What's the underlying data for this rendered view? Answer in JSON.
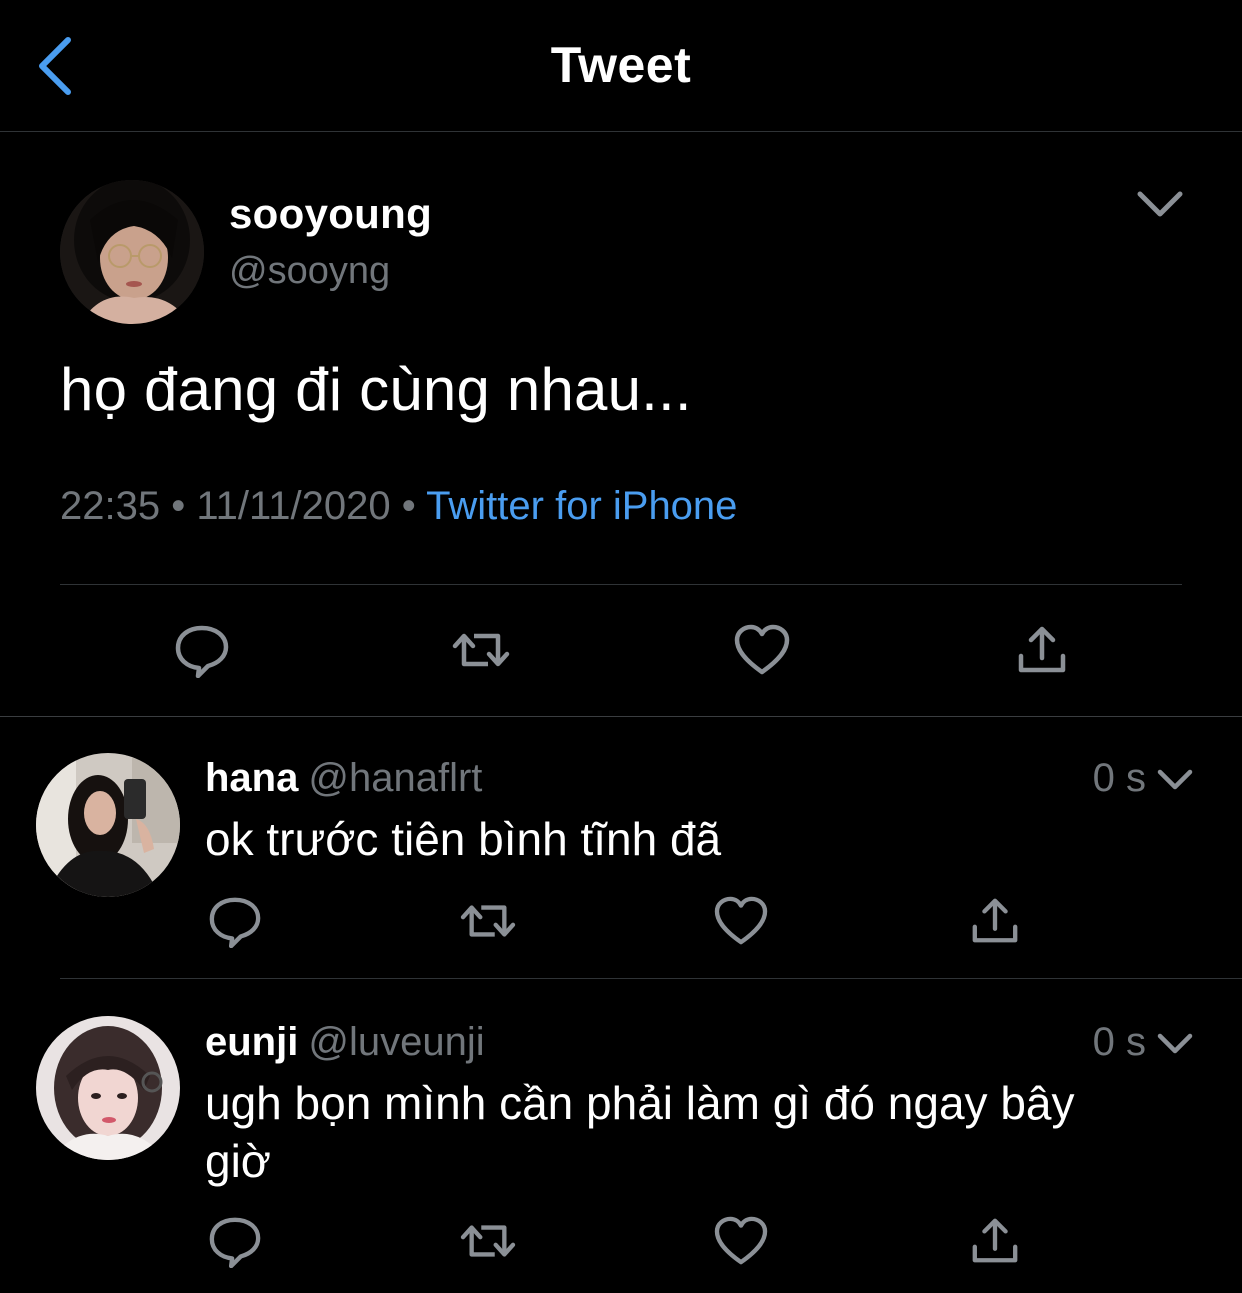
{
  "header": {
    "title": "Tweet",
    "accent_color": "#4a9df0"
  },
  "tweet": {
    "author_name": "sooyoung",
    "author_handle": "@sooyng",
    "text": "họ đang đi cùng nhau...",
    "time": "22:35",
    "date": "11/11/2020",
    "separator": "•",
    "source": "Twitter for iPhone"
  },
  "actions": [
    "reply-icon",
    "retweet-icon",
    "like-icon",
    "share-icon"
  ],
  "replies": [
    {
      "name": "hana",
      "handle": "@hanaflrt",
      "time": "0 s",
      "text": "ok trước tiên bình tĩnh đã"
    },
    {
      "name": "eunji",
      "handle": "@luveunji",
      "time": "0 s",
      "text": "ugh bọn mình cần phải làm gì đó ngay bây giờ"
    }
  ]
}
